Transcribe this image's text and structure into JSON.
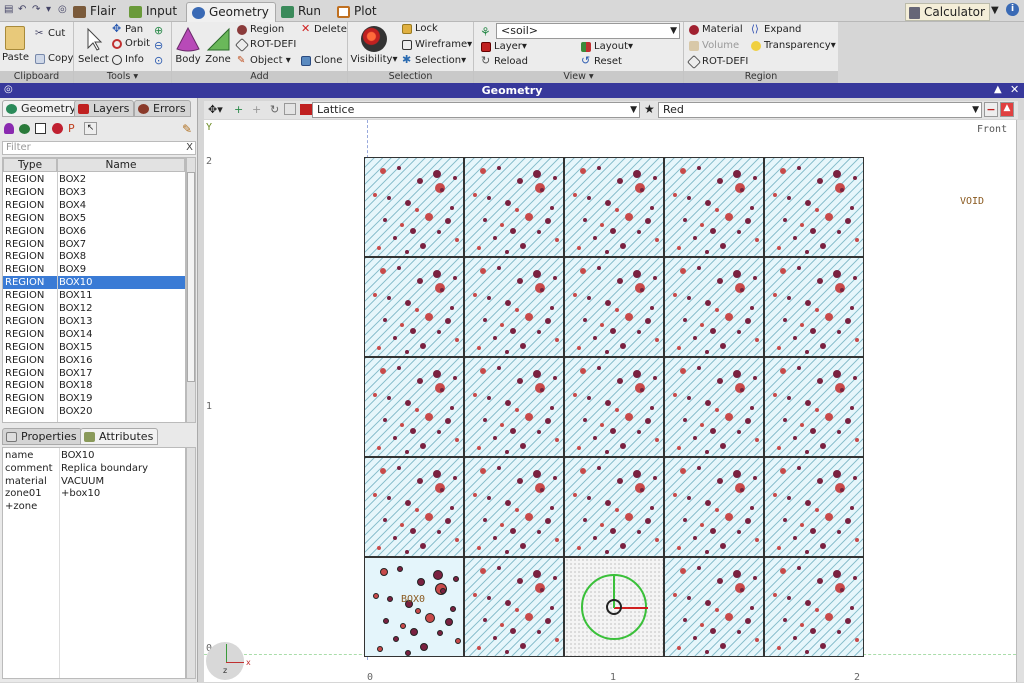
{
  "tabs": [
    {
      "label": "Flair",
      "color": "#7a5a3a"
    },
    {
      "label": "Input",
      "color": "#5a7a3a"
    },
    {
      "label": "Geometry",
      "color": "#3a6ab5"
    },
    {
      "label": "Run",
      "color": "#3a8a5a"
    },
    {
      "label": "Plot",
      "color": "#c07020"
    }
  ],
  "calculator": {
    "label": "Calculator"
  },
  "ribbon": {
    "clipboard": {
      "title": "Clipboard",
      "paste": "Paste",
      "cut": "Cut",
      "copy": "Copy"
    },
    "tools": {
      "title": "Tools",
      "select": "Select",
      "pan": "Pan",
      "orbit": "Orbit",
      "info": "Info"
    },
    "add": {
      "title": "Add",
      "body": "Body",
      "zone": "Zone",
      "region": "Region",
      "rotdefi": "ROT-DEFI",
      "object": "Object",
      "delete": "Delete",
      "clone": "Clone"
    },
    "selection": {
      "title": "Selection",
      "visibility": "Visibility",
      "lock": "Lock",
      "wireframe": "Wireframe",
      "selection": "Selection"
    },
    "view": {
      "title": "View",
      "combo_value": "<soil>",
      "layer": "Layer",
      "layout": "Layout",
      "reload": "Reload",
      "reset": "Reset"
    },
    "region": {
      "title": "Region",
      "material": "Material",
      "expand": "Expand",
      "volume": "Volume",
      "transparency": "Transparency",
      "rotdefi": "ROT-DEFI"
    }
  },
  "geometry_title": "Geometry",
  "left_tabs": {
    "geometry": "Geometry",
    "layers": "Layers",
    "errors": "Errors"
  },
  "filter_placeholder": "Filter",
  "list": {
    "headers": {
      "type": "Type",
      "name": "Name"
    },
    "rows": [
      {
        "type": "REGION",
        "name": "BOX2"
      },
      {
        "type": "REGION",
        "name": "BOX3"
      },
      {
        "type": "REGION",
        "name": "BOX4"
      },
      {
        "type": "REGION",
        "name": "BOX5"
      },
      {
        "type": "REGION",
        "name": "BOX6"
      },
      {
        "type": "REGION",
        "name": "BOX7"
      },
      {
        "type": "REGION",
        "name": "BOX8"
      },
      {
        "type": "REGION",
        "name": "BOX9"
      },
      {
        "type": "REGION",
        "name": "BOX10"
      },
      {
        "type": "REGION",
        "name": "BOX11"
      },
      {
        "type": "REGION",
        "name": "BOX12"
      },
      {
        "type": "REGION",
        "name": "BOX13"
      },
      {
        "type": "REGION",
        "name": "BOX14"
      },
      {
        "type": "REGION",
        "name": "BOX15"
      },
      {
        "type": "REGION",
        "name": "BOX16"
      },
      {
        "type": "REGION",
        "name": "BOX17"
      },
      {
        "type": "REGION",
        "name": "BOX18"
      },
      {
        "type": "REGION",
        "name": "BOX19"
      },
      {
        "type": "REGION",
        "name": "BOX20"
      }
    ],
    "selected_name": "BOX10"
  },
  "prop_tabs": {
    "properties": "Properties",
    "attributes": "Attributes"
  },
  "properties": [
    {
      "key": "name",
      "value": "BOX10"
    },
    {
      "key": "comment",
      "value": "Replica boundary"
    },
    {
      "key": "material",
      "value": "VACUUM"
    },
    {
      "key": "zone01",
      "value": "+box10"
    },
    {
      "key": "+zone",
      "value": ""
    }
  ],
  "viewport": {
    "type_combo": "Lattice",
    "color_combo": "Red",
    "view_label": "Front",
    "void_label": "VOID",
    "box_label": "BOX0",
    "axis_y": "Y",
    "y_ticks": [
      "2",
      "1",
      "0"
    ],
    "x_ticks": [
      "0",
      "1",
      "2"
    ],
    "grid_cols": 5,
    "grid_rows": 5
  },
  "colors": {
    "accent": "#37389b",
    "selection": "#3a7bd5",
    "particle_dark": "#7a2140",
    "particle_light": "#c84a4a"
  }
}
